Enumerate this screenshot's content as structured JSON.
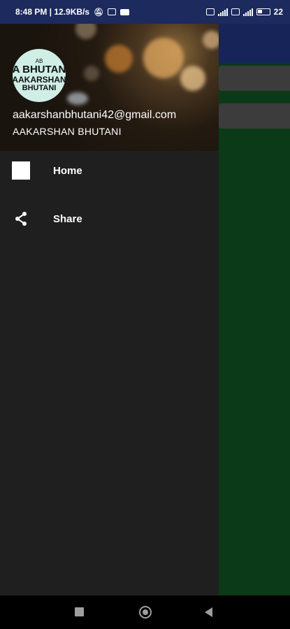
{
  "status_bar": {
    "time_and_speed": "8:48 PM | 12.9KB/s",
    "battery": "22"
  },
  "drawer": {
    "header": {
      "avatar_lines": [
        "AB",
        "A BHUTAN",
        "AAKARSHAN",
        "BHUTANI"
      ],
      "email": "aakarshanbhutani42@gmail.com",
      "username": "AAKARSHAN BHUTANI"
    },
    "items": [
      {
        "label": "Home",
        "icon": "home-square-icon"
      },
      {
        "label": "Share",
        "icon": "share-icon"
      }
    ]
  },
  "colors": {
    "status_bar": "#1c2a5e",
    "drawer_bg": "#1f1f1f",
    "app_bg": "#0b3a18",
    "app_toolbar": "#162457"
  }
}
